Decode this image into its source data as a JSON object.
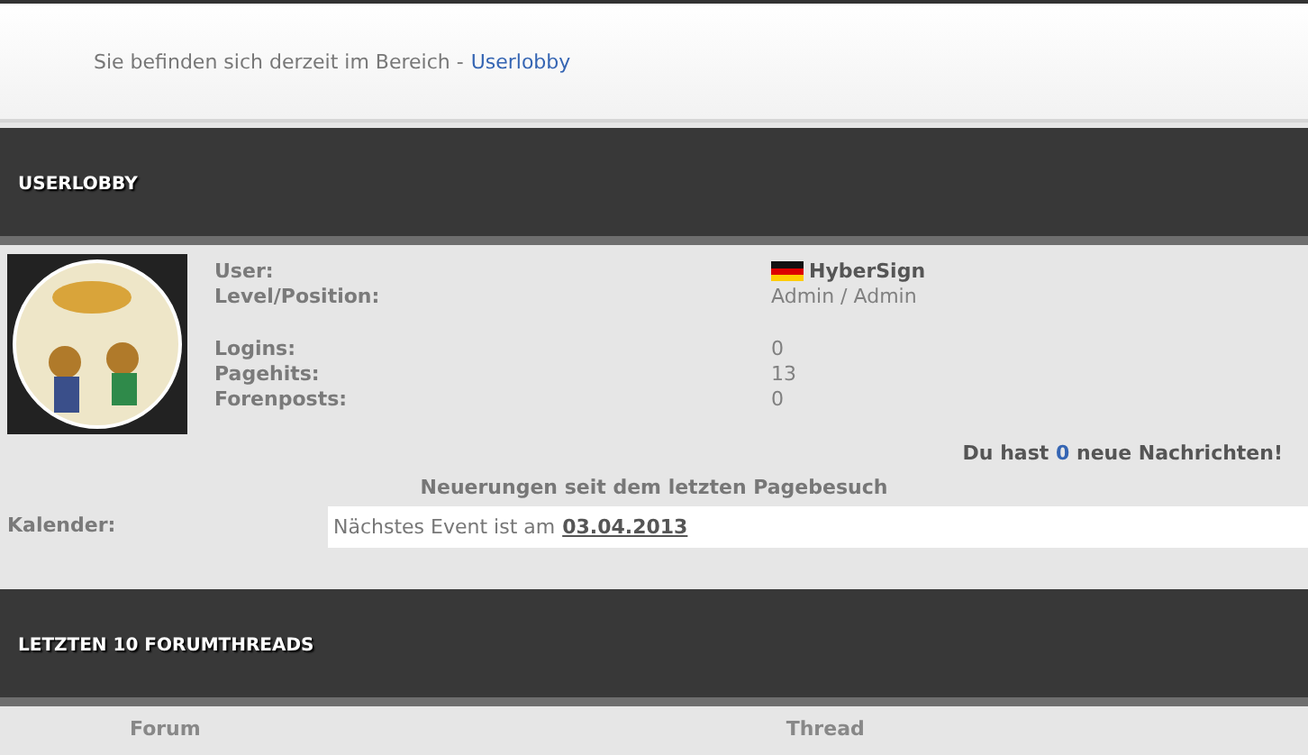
{
  "breadcrumb": {
    "text": "Sie befinden sich derzeit im Bereich -",
    "link": "Userlobby"
  },
  "userlobby": {
    "title": "USERLOBBY",
    "info_groups": [
      [
        {
          "label": "User:",
          "value": "HyberSign",
          "kind": "user"
        },
        {
          "label": "Level/Position:",
          "value": "Admin / Admin",
          "kind": "text"
        }
      ],
      [
        {
          "label": "Logins:",
          "value": "0",
          "kind": "text"
        },
        {
          "label": "Pagehits:",
          "value": "13",
          "kind": "text"
        },
        {
          "label": "Forenposts:",
          "value": "0",
          "kind": "text"
        }
      ]
    ],
    "messages": {
      "prefix": "Du hast",
      "count": "0",
      "suffix": "neue Nachrichten!"
    },
    "news_heading": "Neuerungen seit dem letzten Pagebesuch",
    "calendar": {
      "label": "Kalender:",
      "text": "Nächstes Event ist am",
      "date": "03.04.2013"
    }
  },
  "forumthreads": {
    "title": "LETZTEN 10 FORUMTHREADS",
    "columns": [
      "Forum",
      "Thread"
    ]
  }
}
